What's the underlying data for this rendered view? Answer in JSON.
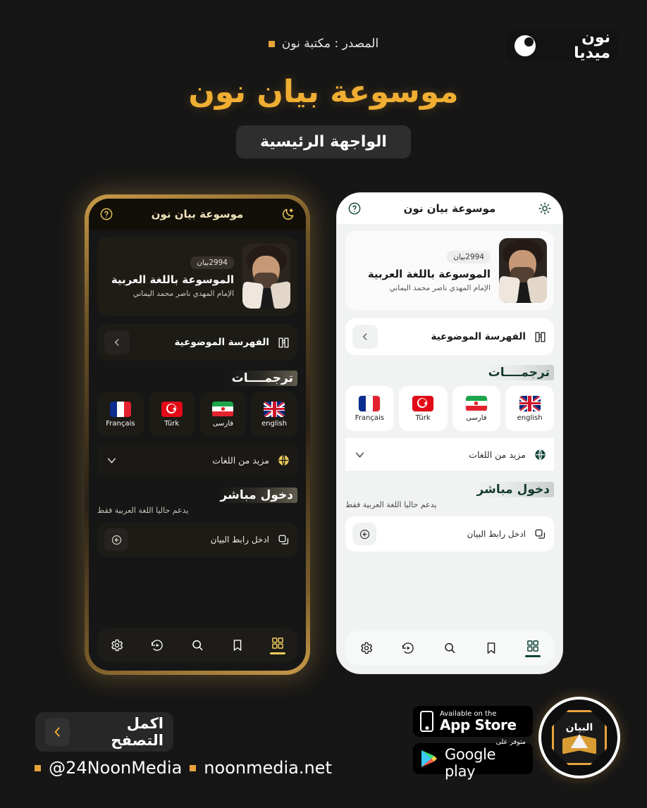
{
  "brand": {
    "name": "نون ميديا",
    "logo_icon": "noon-crescent-logo"
  },
  "header": {
    "source_label": "المصدر : مكتبة نون"
  },
  "title": {
    "main": "موسوعة بيان نون",
    "pill": "الواجهة الرئيسية"
  },
  "app": {
    "header_title": "موسوعة بيان نون",
    "dark_mode_icon": "crescent-moon-icon",
    "light_mode_icon": "sun-icon",
    "help_icon": "question-mark-circle-icon",
    "profile": {
      "count_badge": "2994بيان",
      "name": "الموسوعة باللغة العربية",
      "subtitle": "الإمام المهدي ناصر محمد اليماني",
      "avatar_name": "scholar-portrait"
    },
    "index_row": {
      "label": "الفهرسة الموضوعية",
      "icon": "index-book-icon",
      "chevron": "chevron-left-icon"
    },
    "translations": {
      "heading": "ترجمــــات",
      "items": [
        {
          "label": "english",
          "flag": "uk-flag"
        },
        {
          "label": "فارسی",
          "flag": "iran-flag"
        },
        {
          "label": "Türk",
          "flag": "turkey-flag"
        },
        {
          "label": "Français",
          "flag": "france-flag"
        }
      ]
    },
    "more_languages": {
      "label": "مزيد من اللغات",
      "icon": "globe-icon",
      "chevron": "chevron-down-icon"
    },
    "direct_entry": {
      "heading": "دخول مباشر",
      "note": "يدعم حاليا اللغة العربية فقط",
      "input_label": "ادخل رابط البيان",
      "input_icon": "link-copy-icon",
      "submit_icon": "arrow-left-circle-icon"
    },
    "nav": [
      {
        "name": "settings",
        "icon": "gear-icon",
        "active": false
      },
      {
        "name": "history",
        "icon": "history-icon",
        "active": false
      },
      {
        "name": "search",
        "icon": "search-icon",
        "active": false
      },
      {
        "name": "bookmarks",
        "icon": "bookmark-icon",
        "active": false
      },
      {
        "name": "home",
        "icon": "grid-icon",
        "active": true
      }
    ]
  },
  "footer": {
    "cta_label": "اكمل التصفح",
    "cta_icon": "chevron-left-icon",
    "social_handle": "@24NoonMedia",
    "website": "noonmedia.net",
    "app_store": {
      "small": "Available on the",
      "big": "App Store",
      "icon": "iphone-icon"
    },
    "google_play": {
      "small": "متوفر على",
      "big": "Google play",
      "icon": "play-triangle-icon"
    },
    "circle_logo": {
      "word": "البيان",
      "icon": "bayan-book-logo"
    }
  },
  "colors": {
    "background": "#161616",
    "gold": "#f0ae32",
    "dark_accent": "#f0cd5e",
    "light_accent": "#0f4236",
    "orange_square": "#e8a33d"
  }
}
